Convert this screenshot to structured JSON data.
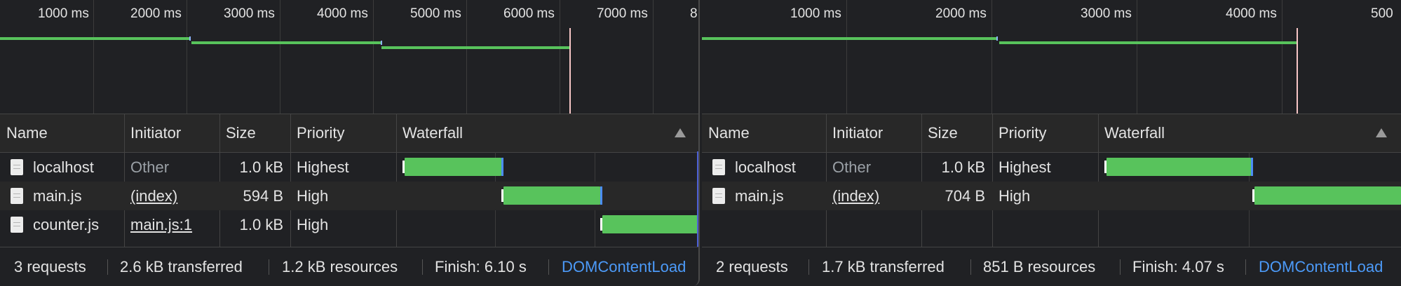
{
  "left": {
    "ticks": [
      "1000 ms",
      "2000 ms",
      "3000 ms",
      "4000 ms",
      "5000 ms",
      "6000 ms",
      "7000 ms",
      "8"
    ],
    "columns": {
      "name": "Name",
      "initiator": "Initiator",
      "size": "Size",
      "priority": "Priority",
      "waterfall": "Waterfall"
    },
    "rows": [
      {
        "name": "localhost",
        "initiator": "Other",
        "size": "1.0 kB",
        "priority": "Highest"
      },
      {
        "name": "main.js",
        "initiator": "(index)",
        "size": "594 B",
        "priority": "High"
      },
      {
        "name": "counter.js",
        "initiator": "main.js:1",
        "size": "1.0 kB",
        "priority": "High"
      }
    ],
    "status": {
      "requests": "3 requests",
      "transferred": "2.6 kB transferred",
      "resources": "1.2 kB resources",
      "finish": "Finish: 6.10 s",
      "dcl": "DOMContentLoad"
    }
  },
  "right": {
    "ticks": [
      "1000 ms",
      "2000 ms",
      "3000 ms",
      "4000 ms",
      "500"
    ],
    "columns": {
      "name": "Name",
      "initiator": "Initiator",
      "size": "Size",
      "priority": "Priority",
      "waterfall": "Waterfall"
    },
    "rows": [
      {
        "name": "localhost",
        "initiator": "Other",
        "size": "1.0 kB",
        "priority": "Highest"
      },
      {
        "name": "main.js",
        "initiator": "(index)",
        "size": "704 B",
        "priority": "High"
      }
    ],
    "status": {
      "requests": "2 requests",
      "transferred": "1.7 kB transferred",
      "resources": "851 B resources",
      "finish": "Finish: 4.07 s",
      "dcl": "DOMContentLoad"
    }
  },
  "colors": {
    "bar": "#58c35c",
    "link": "#4c9af8",
    "background": "#202124"
  },
  "icons": {
    "file": "document-icon",
    "sort": "sort-ascending-icon"
  }
}
